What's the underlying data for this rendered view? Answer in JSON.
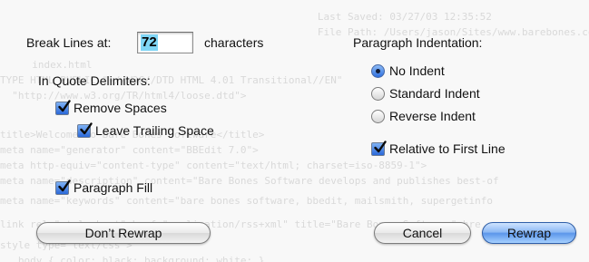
{
  "backdrop": {
    "lines": [
      "   Last Saved: 03/27/03 12:35:52",
      "   File Path: /Users/jason/Sites/www.barebones.com/index.html",
      "  index.html",
      "TYPE HTML PUBLIC \"-//W3C//DTD HTML 4.01 Transitional//EN\"",
      "  \"http://www.w3.org/TR/html4/loose.dtd\">",
      "",
      "",
      "title>Welcome to Bare Bones Software</title>",
      "meta name=\"generator\" content=\"BBEdit 7.0\">",
      "meta http-equiv=\"content-type\" content=\"text/html; charset=iso-8859-1\">",
      "meta name=\"description\" content=\"Bare Bones Software develops and publishes best-of",
      "",
      "meta name=\"keywords\" content=\"bare bones software, bbedit, mailsmith, supergetinfo",
      "",
      "link rel=\"stylesheet\" href=\"application/rss+xml\" title=\"Bare Bones Software\" hre",
      "",
      "style type=\"text/css\">",
      "   body { color: black; background: white; }"
    ]
  },
  "break_lines": {
    "label": "Break Lines at:",
    "value": "72",
    "suffix": "characters"
  },
  "quote": {
    "heading": "In Quote Delimiters:",
    "remove_spaces": {
      "label": "Remove Spaces",
      "checked": true
    },
    "leave_trailing": {
      "label": "Leave Trailing Space",
      "checked": true
    }
  },
  "paragraph_fill": {
    "label": "Paragraph Fill",
    "checked": true
  },
  "indentation": {
    "heading": "Paragraph Indentation:",
    "options": [
      {
        "label": "No Indent",
        "selected": true
      },
      {
        "label": "Standard Indent",
        "selected": false
      },
      {
        "label": "Reverse Indent",
        "selected": false
      }
    ],
    "relative": {
      "label": "Relative to First Line",
      "checked": true
    }
  },
  "buttons": {
    "dont_rewrap": "Don’t Rewrap",
    "cancel": "Cancel",
    "rewrap": "Rewrap"
  },
  "colors": {
    "accent": "#2a68d9",
    "selection": "#7fd5f5"
  }
}
